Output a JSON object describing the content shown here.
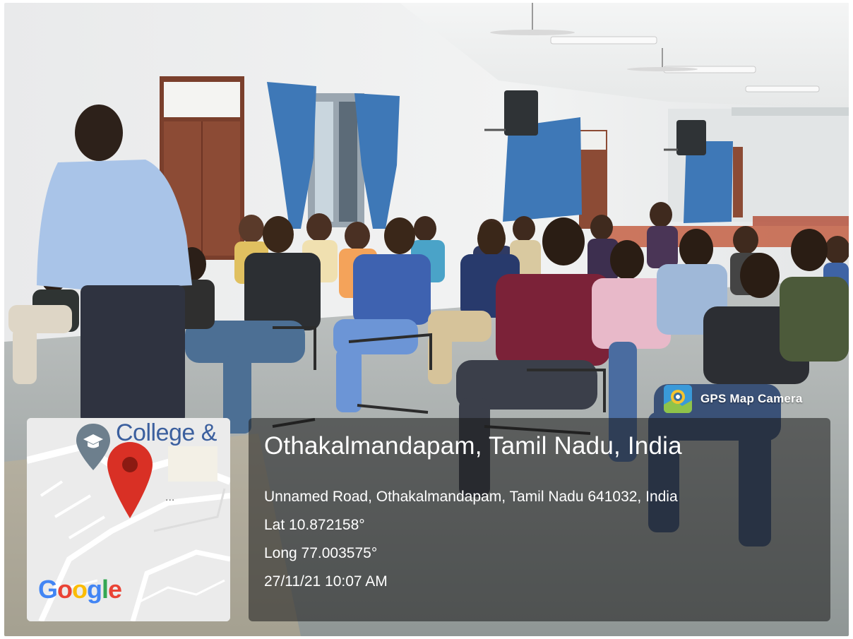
{
  "badge": {
    "label": "GPS Map Camera",
    "icon": "gps-map-camera-app-icon"
  },
  "map": {
    "place_label": "College &",
    "ellipsis": "...",
    "logo_text": [
      "G",
      "o",
      "o",
      "g",
      "l",
      "e"
    ],
    "pin_icon": "map-pin-icon",
    "poi_icon": "school-poi-icon"
  },
  "location": {
    "place": "Othakalmandapam, Tamil Nadu, India",
    "address": "Unnamed Road, Othakalmandapam, Tamil Nadu 641032, India",
    "latitude": "Lat 10.872158°",
    "longitude": "Long 77.003575°",
    "datetime": "27/11/21 10:07 AM"
  },
  "colors": {
    "pin_red": "#d93025",
    "panel_overlay": "rgba(25,25,25,0.55)",
    "curtain_blue": "#3e78b7",
    "door_brown": "#8c4b35"
  }
}
